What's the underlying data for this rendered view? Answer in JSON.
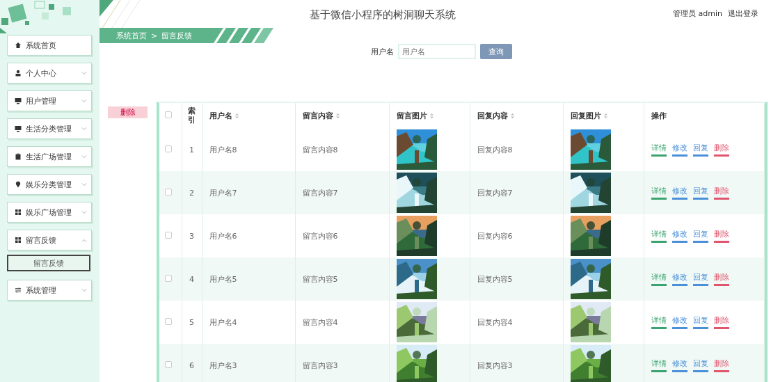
{
  "sidebar": {
    "items": [
      {
        "label": "系统首页",
        "has_children": false,
        "expanded": false
      },
      {
        "label": "个人中心",
        "has_children": true,
        "expanded": false
      },
      {
        "label": "用户管理",
        "has_children": true,
        "expanded": false
      },
      {
        "label": "生活分类管理",
        "has_children": true,
        "expanded": false
      },
      {
        "label": "生活广场管理",
        "has_children": true,
        "expanded": false
      },
      {
        "label": "娱乐分类管理",
        "has_children": true,
        "expanded": false
      },
      {
        "label": "娱乐广场管理",
        "has_children": true,
        "expanded": false
      },
      {
        "label": "留言反馈",
        "has_children": true,
        "expanded": true,
        "children": [
          {
            "label": "留言反馈",
            "selected": true
          }
        ]
      },
      {
        "label": "系统管理",
        "has_children": true,
        "expanded": false
      }
    ]
  },
  "header": {
    "title": "基于微信小程序的树洞聊天系统",
    "user": "管理员 admin",
    "logout": "退出登录"
  },
  "breadcrumb": [
    "系统首页",
    "留言反馈"
  ],
  "breadcrumb_separator": ">",
  "search": {
    "label": "用户名",
    "placeholder": "用户名",
    "button": "查询"
  },
  "delete_button": "删除",
  "table": {
    "select_all_checked": false,
    "columns": [
      {
        "label": "索引",
        "sortable": false
      },
      {
        "label": "用户名",
        "sortable": true
      },
      {
        "label": "留言内容",
        "sortable": true
      },
      {
        "label": "留言图片",
        "sortable": true
      },
      {
        "label": "回复内容",
        "sortable": true
      },
      {
        "label": "回复图片",
        "sortable": true
      },
      {
        "label": "操作",
        "sortable": false
      }
    ],
    "rows": [
      {
        "checked": false,
        "index": "1",
        "username": "用户名8",
        "message": "留言内容8",
        "reply": "回复内容8",
        "actions": [
          {
            "label": "详情",
            "color": "#3aa36f"
          },
          {
            "label": "修改",
            "color": "#4a90d9"
          },
          {
            "label": "回复",
            "color": "#4a90d9"
          },
          {
            "label": "删除",
            "color": "#e0566e"
          }
        ]
      },
      {
        "checked": false,
        "index": "2",
        "username": "用户名7",
        "message": "留言内容7",
        "reply": "回复内容7",
        "actions": [
          {
            "label": "详情",
            "color": "#3aa36f"
          },
          {
            "label": "修改",
            "color": "#4a90d9"
          },
          {
            "label": "回复",
            "color": "#4a90d9"
          },
          {
            "label": "删除",
            "color": "#e0566e"
          }
        ]
      },
      {
        "checked": false,
        "index": "3",
        "username": "用户名6",
        "message": "留言内容6",
        "reply": "回复内容6",
        "actions": [
          {
            "label": "详情",
            "color": "#3aa36f"
          },
          {
            "label": "修改",
            "color": "#4a90d9"
          },
          {
            "label": "回复",
            "color": "#4a90d9"
          },
          {
            "label": "删除",
            "color": "#e0566e"
          }
        ]
      },
      {
        "checked": false,
        "index": "4",
        "username": "用户名5",
        "message": "留言内容5",
        "reply": "回复内容5",
        "actions": [
          {
            "label": "详情",
            "color": "#3aa36f"
          },
          {
            "label": "修改",
            "color": "#4a90d9"
          },
          {
            "label": "回复",
            "color": "#4a90d9"
          },
          {
            "label": "删除",
            "color": "#e0566e"
          }
        ]
      },
      {
        "checked": false,
        "index": "5",
        "username": "用户名4",
        "message": "留言内容4",
        "reply": "回复内容4",
        "actions": [
          {
            "label": "详情",
            "color": "#3aa36f"
          },
          {
            "label": "修改",
            "color": "#4a90d9"
          },
          {
            "label": "回复",
            "color": "#4a90d9"
          },
          {
            "label": "删除",
            "color": "#e0566e"
          }
        ]
      },
      {
        "checked": false,
        "index": "6",
        "username": "用户名3",
        "message": "留言内容3",
        "reply": "回复内容3",
        "actions": [
          {
            "label": "详情",
            "color": "#3aa36f"
          },
          {
            "label": "修改",
            "color": "#4a90d9"
          },
          {
            "label": "回复",
            "color": "#4a90d9"
          },
          {
            "label": "删除",
            "color": "#e0566e"
          }
        ]
      }
    ]
  }
}
